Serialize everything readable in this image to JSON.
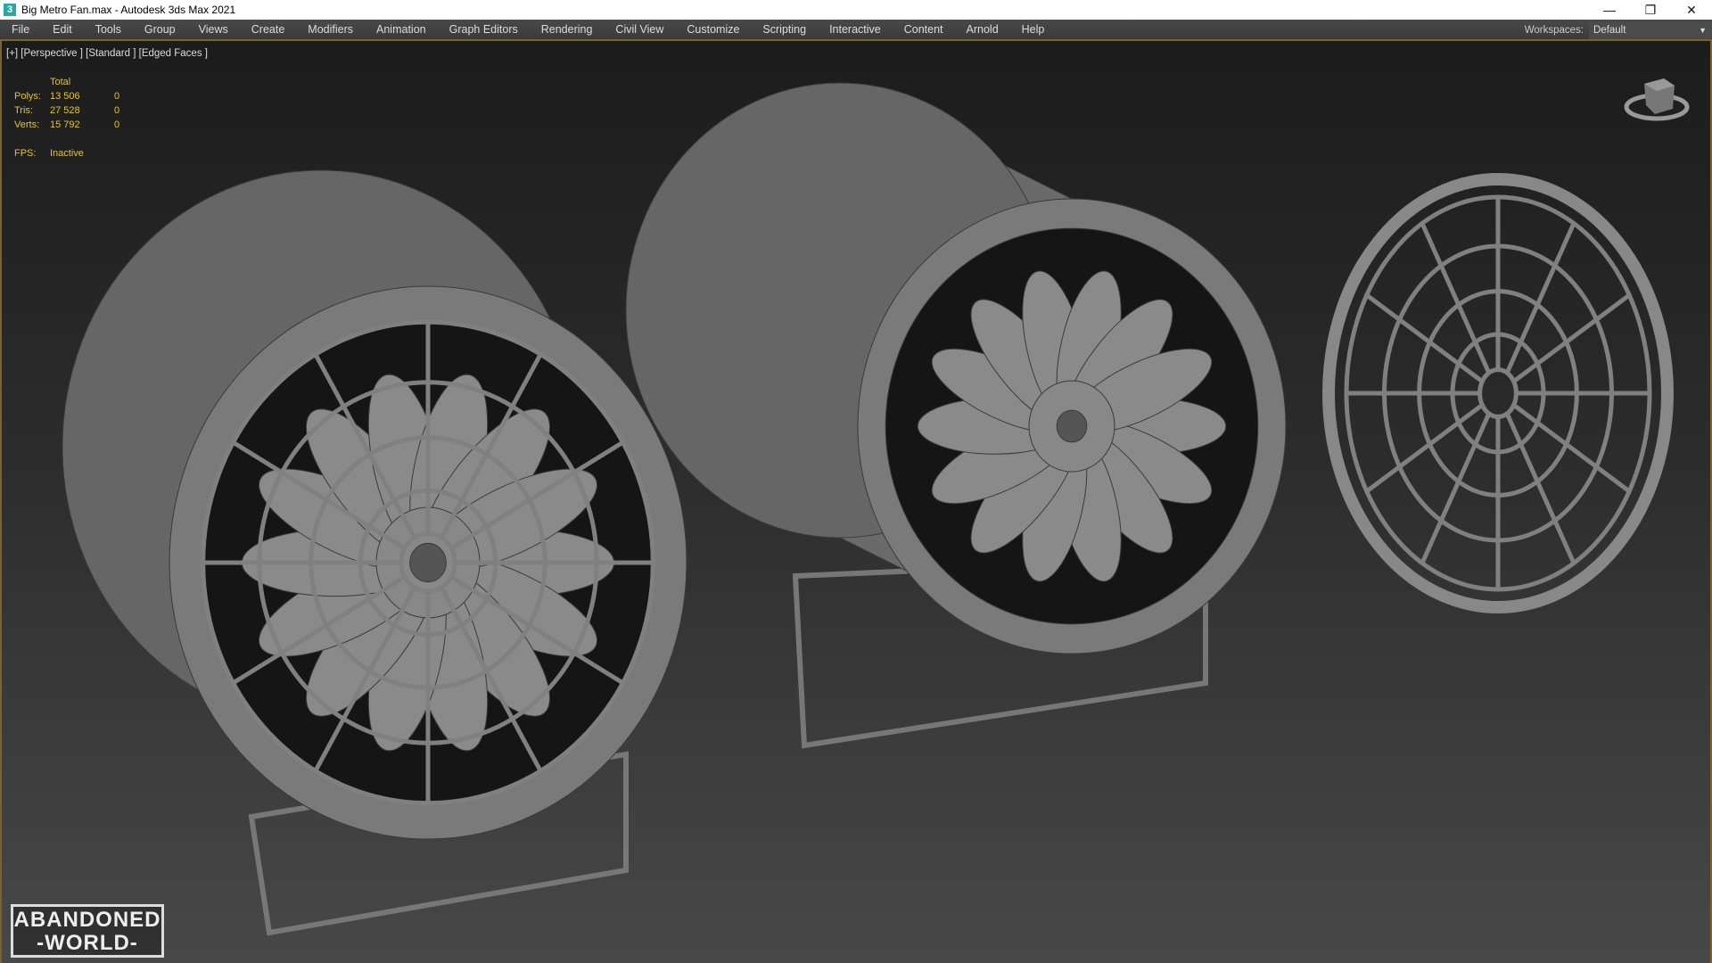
{
  "window": {
    "title": "Big Metro Fan.max - Autodesk 3ds Max 2021",
    "app_icon": "3",
    "minimize": "—",
    "restore": "❐",
    "close": "✕"
  },
  "menu": [
    "File",
    "Edit",
    "Tools",
    "Group",
    "Views",
    "Create",
    "Modifiers",
    "Animation",
    "Graph Editors",
    "Rendering",
    "Civil View",
    "Customize",
    "Scripting",
    "Interactive",
    "Content",
    "Arnold",
    "Help"
  ],
  "workspaces": {
    "label": "Workspaces:",
    "value": "Default"
  },
  "viewport": {
    "label": "[+] [Perspective ] [Standard ] [Edged Faces ]"
  },
  "stats": {
    "header": "Total",
    "rows": [
      {
        "k": "Polys:",
        "v": "13 506",
        "s": "0"
      },
      {
        "k": "Tris:",
        "v": "27 528",
        "s": "0"
      },
      {
        "k": "Verts:",
        "v": "15 792",
        "s": "0"
      }
    ],
    "fps_label": "FPS:",
    "fps_value": "Inactive"
  },
  "logo": {
    "line1": "ABANDONED",
    "line2": "-WORLD-"
  },
  "colors": {
    "accent": "#7a6428",
    "stats": "#e5c42a"
  }
}
